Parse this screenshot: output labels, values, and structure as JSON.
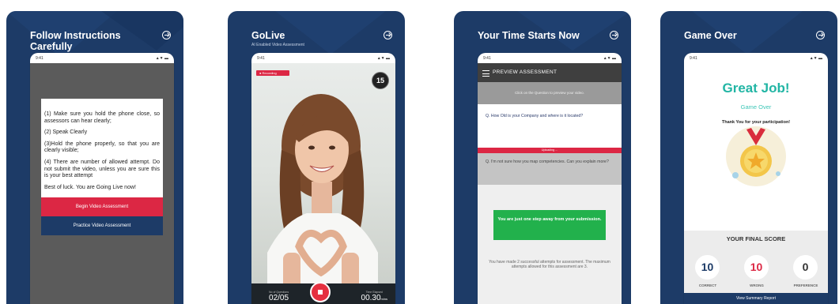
{
  "colors": {
    "navy": "#1d3b67",
    "red": "#dc2744",
    "teal": "#21b5a4",
    "green": "#22b14c"
  },
  "screens": [
    {
      "title": "Follow Instructions Carefully",
      "instructions": [
        "(1) Make sure you hold the phone close, so assessors can hear clearly;",
        "(2) Speak Clearly",
        "(3)Hold the phone properly, so that you are clearly visible;",
        "(4) There are number of allowed attempt. Do not submit the video, unless you are sure this is your best attempt",
        "Best of luck. You are Going Live now!"
      ],
      "primary_button": "Begin Video Assessment",
      "secondary_button": "Practice Video Assessment"
    },
    {
      "title": "GoLive",
      "subtitle": "AI Enabled Video Assessment",
      "recording_badge": "● Recording",
      "countdown": "15",
      "questions_label": "No of Questions",
      "questions_value": "02/05",
      "time_label": "Time Elapsed",
      "time_value": "00.30",
      "time_unit": "mins"
    },
    {
      "title": "Your Time Starts Now",
      "header": "PREVIEW ASSESSMENT",
      "hint": "Click on the Question to preview your video.",
      "question1": "Q. How Old is your Company and where is it located?",
      "uploading": "Uploading ...",
      "question2": "Q. I'm not sure how you map competencies. Can you explain more?",
      "success": "You are just one step away from your submission.",
      "attempt_note": "You have made 2 successful attempts for assessment. The maximum attempts allowed for this assessment are 3."
    },
    {
      "title": "Game Over",
      "great_job": "Great Job!",
      "game_over": "Game Over",
      "thanks": "Thank You for your participation!",
      "final_score_label": "YOUR FINAL SCORE",
      "scores": [
        {
          "value": "10",
          "label": "CORRECT",
          "color": "#1d3b67"
        },
        {
          "value": "10",
          "label": "WRONG",
          "color": "#dc2744"
        },
        {
          "value": "0",
          "label": "PREFERENCE",
          "color": "#333333"
        }
      ],
      "view_report": "View Summary Report"
    }
  ],
  "status": {
    "time": "9:41",
    "icons": "▲▼ ▬"
  }
}
